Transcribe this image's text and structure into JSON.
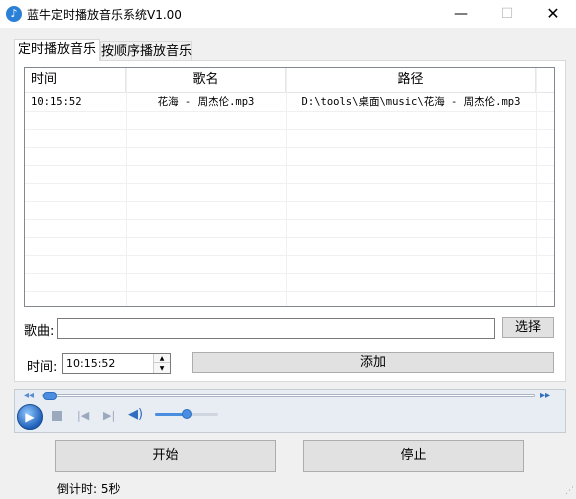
{
  "window": {
    "title": "蓝牛定时播放音乐系统V1.00",
    "minimize_glyph": "—",
    "maximize_glyph": "☐",
    "close_glyph": "✕"
  },
  "tabs": [
    {
      "label": "定时播放音乐",
      "active": true
    },
    {
      "label": "按顺序播放音乐",
      "active": false
    }
  ],
  "grid": {
    "columns": [
      "时间",
      "歌名",
      "路径"
    ],
    "rows": [
      {
        "time": "10:15:52",
        "name": "花海 - 周杰伦.mp3",
        "path": "D:\\tools\\桌面\\music\\花海 - 周杰伦.mp3"
      }
    ]
  },
  "song": {
    "label": "歌曲:",
    "value": "",
    "choose_label": "选择"
  },
  "time_field": {
    "label": "时间:",
    "value": "10:15:52",
    "add_label": "添加"
  },
  "player": {
    "seek_fraction": 0.01,
    "volume_fraction": 0.5,
    "icons": [
      "rewind-icon",
      "play-icon",
      "stop-icon",
      "previous-icon",
      "next-icon",
      "volume-icon",
      "fast-forward-icon"
    ]
  },
  "buttons": {
    "start_label": "开始",
    "stop_label": "停止"
  },
  "status": {
    "countdown": "倒计时: 5秒"
  },
  "colors": {
    "accent": "#2a7fd6",
    "window_bg": "#f0f0f0"
  }
}
